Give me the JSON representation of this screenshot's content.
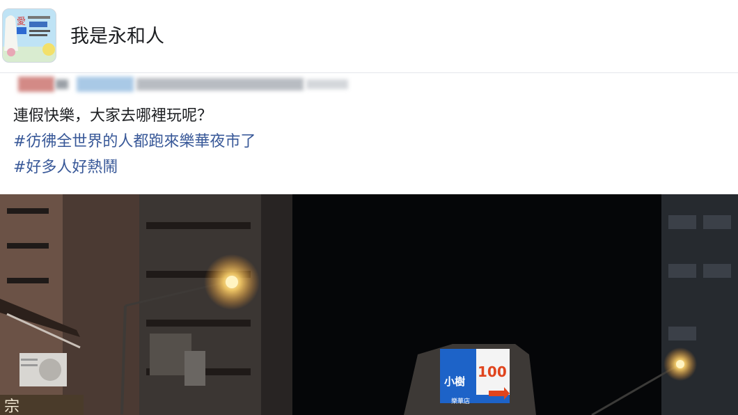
{
  "group": {
    "name": "我是永和人",
    "avatar_icon": "group-avatar-icon"
  },
  "post": {
    "line1": "連假快樂，大家去哪裡玩呢？",
    "hashtag1": "#彷彿全世界的人都跑來樂華夜市了",
    "hashtag2": "#好多人好熱鬧"
  },
  "photo": {
    "billboard_brand": "小樹",
    "billboard_price": "100",
    "billboard_branch": "樂華店"
  },
  "colors": {
    "text": "#1c1e21",
    "hashtag": "#385898",
    "night_sky": "#050608"
  }
}
